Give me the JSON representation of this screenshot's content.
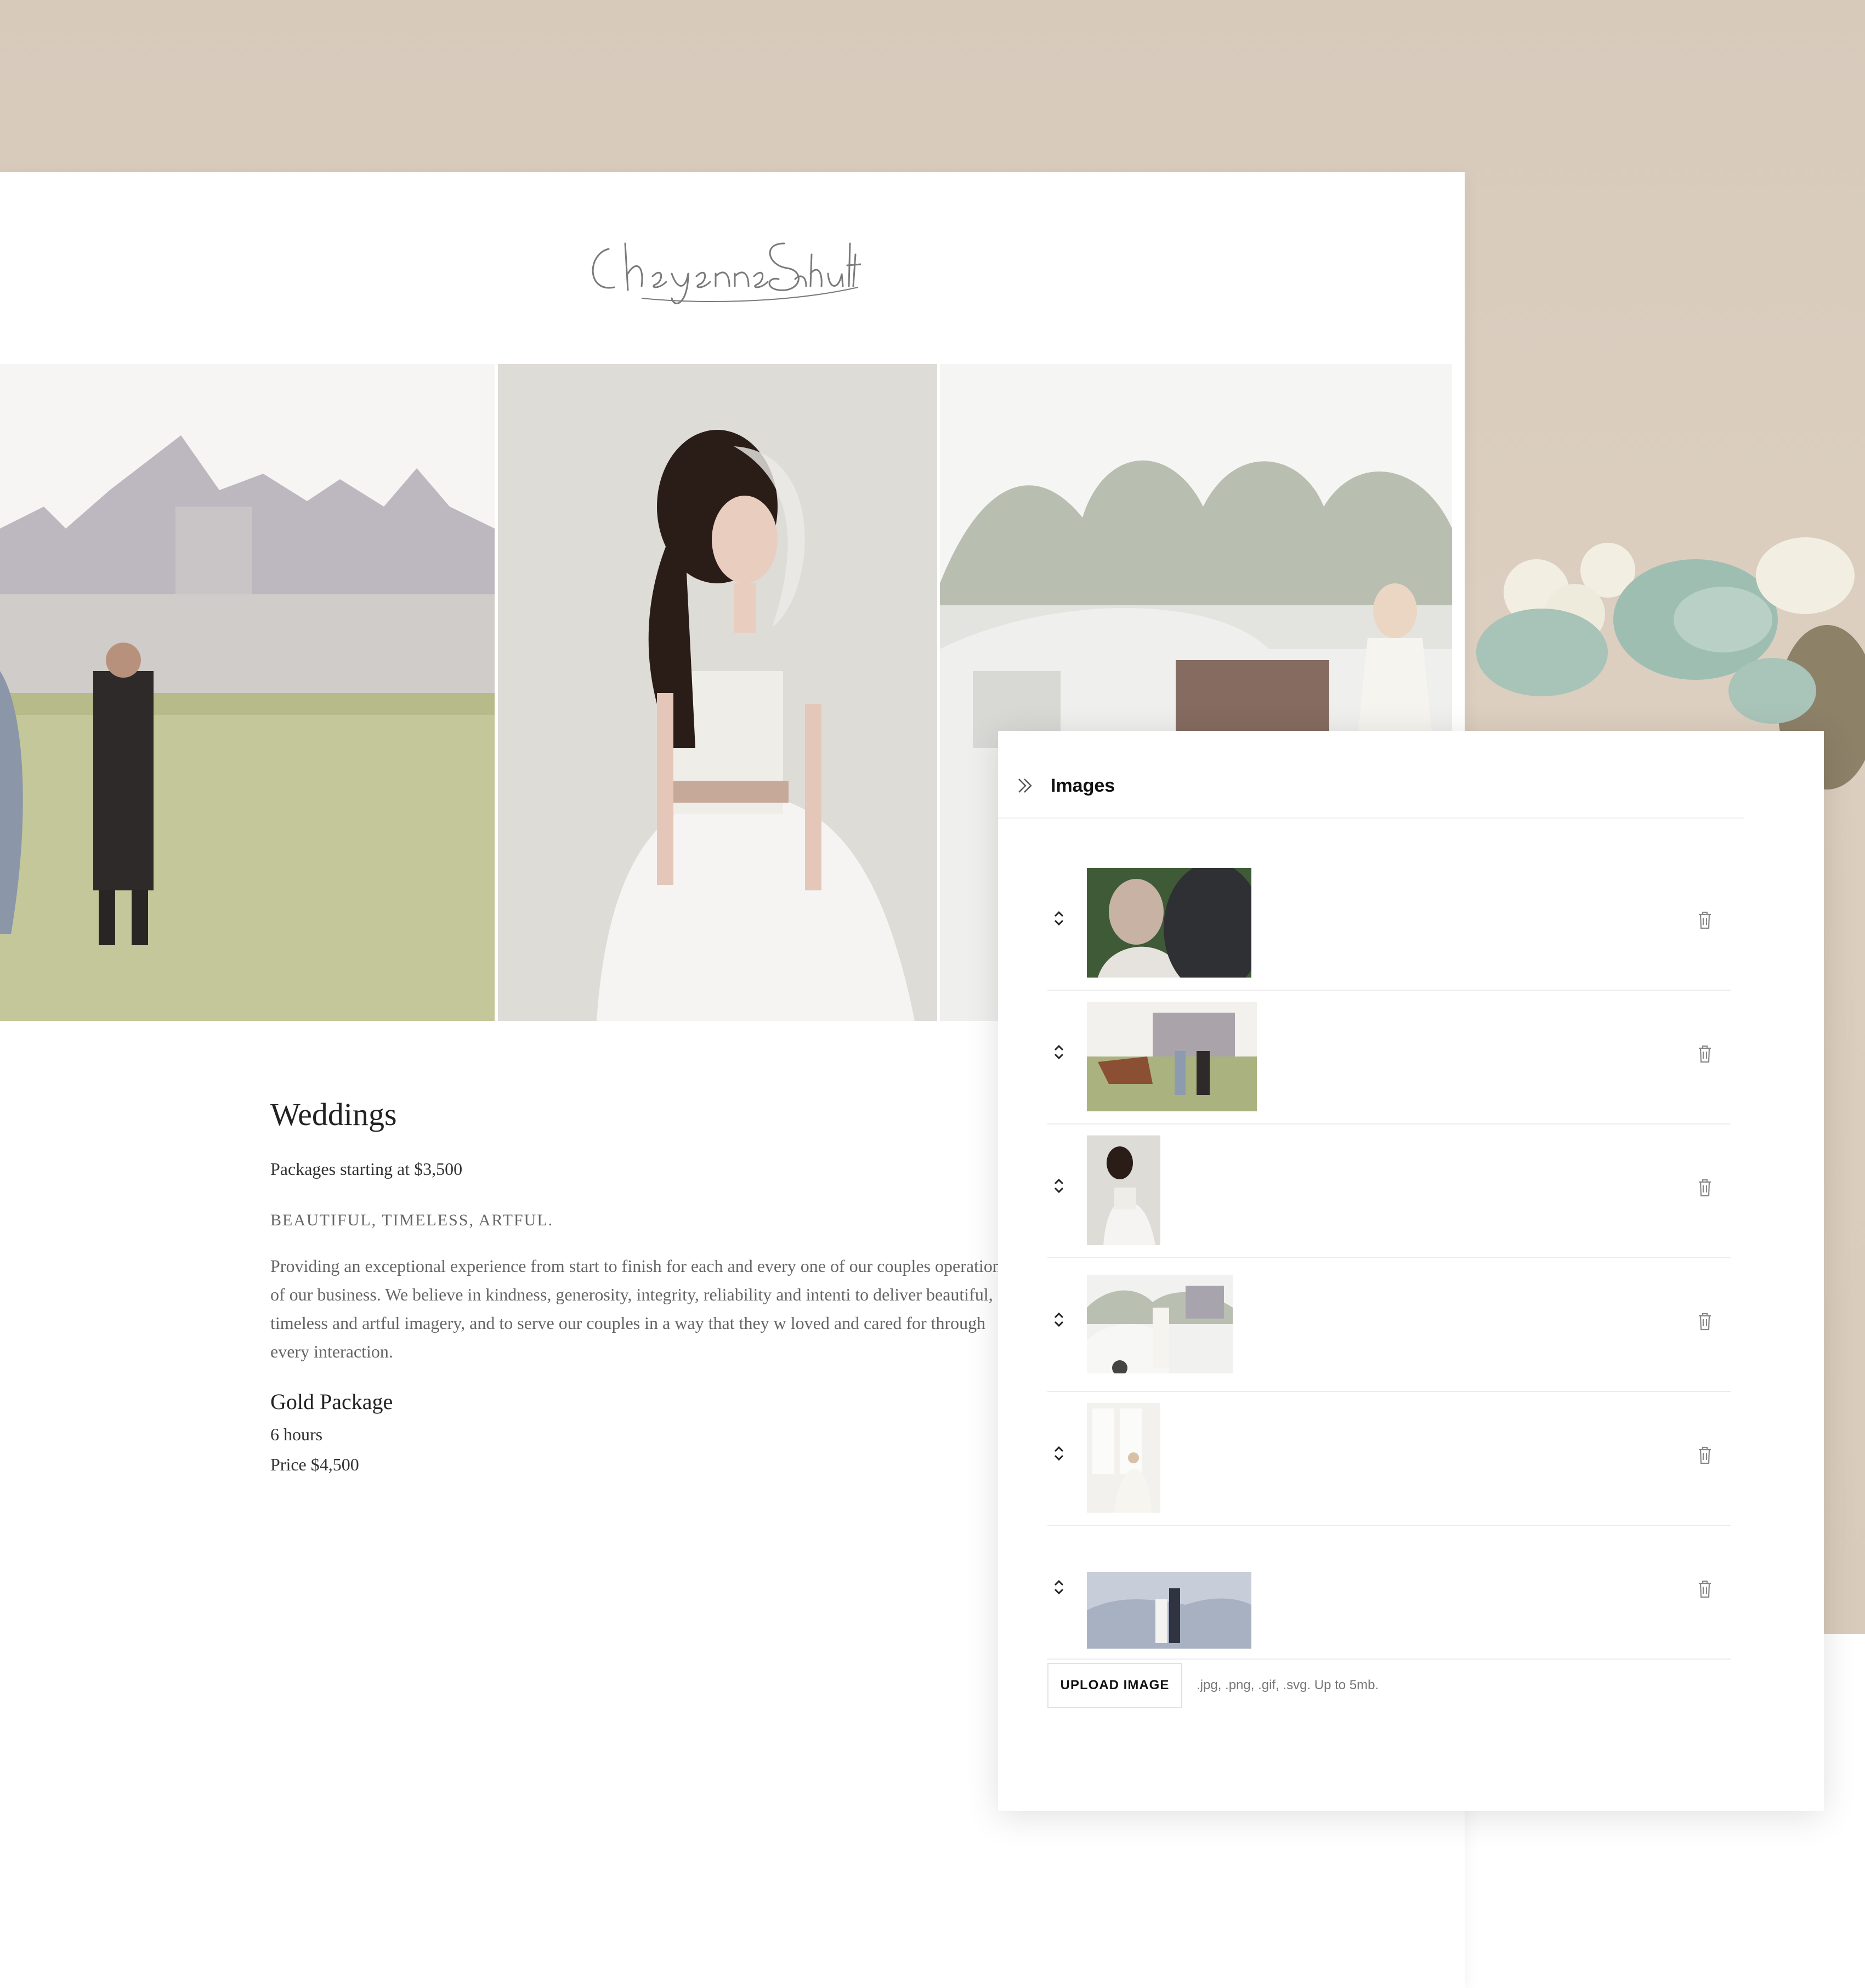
{
  "brand": {
    "logo_text": "Cheyenne Schultz"
  },
  "page": {
    "title": "Weddings",
    "price_line": "Packages starting at $3,500",
    "tagline": "BEAUTIFUL, TIMELESS, ARTFUL.",
    "description": "Providing an exceptional experience from start to finish for each and every one of our couples operation of our business. We believe in kindness, generosity, integrity, reliability and intenti to deliver beautiful, timeless and artful imagery, and to serve our couples in a way that they w loved and cared for through every interaction.",
    "package": {
      "name": "Gold Package",
      "duration": "6 hours",
      "price": "Price $4,500"
    }
  },
  "gallery": {
    "photos": [
      {
        "subject": "couple-walking-toward-castle"
      },
      {
        "subject": "bride-portrait"
      },
      {
        "subject": "bride-with-vintage-car"
      }
    ]
  },
  "images_panel": {
    "title": "Images",
    "items": [
      {
        "subject": "father-and-bride-embrace"
      },
      {
        "subject": "couple-with-horse-near-castle"
      },
      {
        "subject": "bride-portrait"
      },
      {
        "subject": "bride-with-vintage-car"
      },
      {
        "subject": "bride-by-window"
      },
      {
        "subject": "couple-in-misty-mountains"
      }
    ],
    "upload_label": "UPLOAD IMAGE",
    "upload_hint": ".jpg, .png, .gif, .svg. Up to 5mb."
  },
  "icons": {
    "collapse": "double-chevron-right-icon",
    "drag": "drag-handle-icon",
    "delete": "trash-icon"
  },
  "colors": {
    "backdrop": "#d9ccbd",
    "panel_bg": "#ffffff",
    "text_dark": "#222222",
    "text_muted": "#666666"
  }
}
